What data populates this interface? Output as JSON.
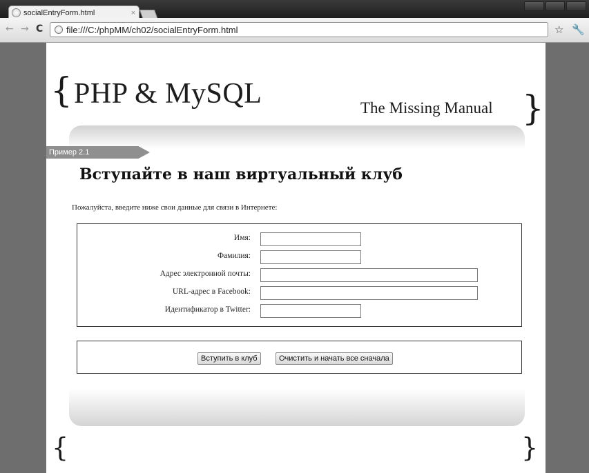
{
  "browser": {
    "tab": {
      "title": "socialEntryForm.html",
      "close": "×"
    },
    "nav": {
      "back": "←",
      "forward": "→",
      "reload": "C"
    },
    "address": "file:///C:/phpMM/ch02/socialEntryForm.html",
    "star": "☆",
    "wrench": "🔧"
  },
  "page": {
    "logo": {
      "title": "PHP & MySQL",
      "subtitle": "The Missing Manual",
      "brace_open": "{",
      "brace_close": "}"
    },
    "example_tag": "Пример 2.1",
    "heading": "Вступайте в наш виртуальный клуб",
    "intro": "Пожалуйста, введите ниже свои данные для связи в Интернете:",
    "fields": [
      {
        "label": "Имя:",
        "value": ""
      },
      {
        "label": "Фамилия:",
        "value": ""
      },
      {
        "label": "Адрес электронной почты:",
        "value": ""
      },
      {
        "label": "URL-адрес в Facebook:",
        "value": ""
      },
      {
        "label": "Идентификатор в Twitter:",
        "value": ""
      }
    ],
    "buttons": {
      "join": "Вступить в клуб",
      "reset": "Очистить и начать все сначала"
    }
  }
}
